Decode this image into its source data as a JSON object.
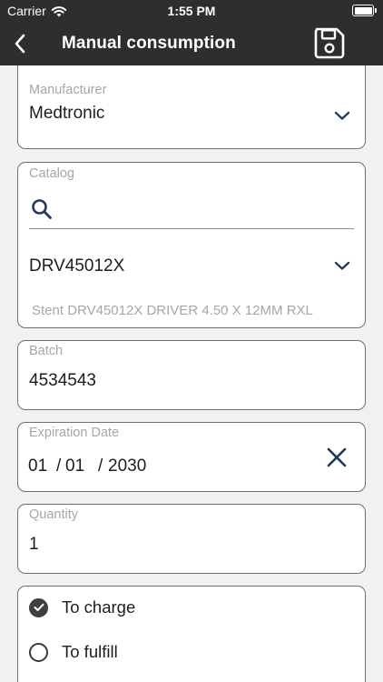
{
  "status_bar": {
    "carrier": "Carrier",
    "time": "1:55 PM",
    "icons": [
      "wifi-icon",
      "battery-icon"
    ]
  },
  "nav": {
    "title": "Manual consumption",
    "back_icon": "chevron-left-icon",
    "save_icon": "floppy-disk-icon"
  },
  "form": {
    "manufacturer": {
      "label": "Manufacturer",
      "value": "Medtronic"
    },
    "catalog": {
      "label": "Catalog",
      "search_value": "",
      "selected": "DRV45012X",
      "description": "Stent DRV45012X DRIVER 4.50 X 12MM RXL"
    },
    "batch": {
      "label": "Batch",
      "value": "4534543"
    },
    "expiration_date": {
      "label": "Expiration Date",
      "month": "01",
      "separator1": "/",
      "day": "01",
      "separator2": "/",
      "year": "2030"
    },
    "quantity": {
      "label": "Quantity",
      "value": "1"
    },
    "charge_options": [
      {
        "label": "To charge",
        "checked": true
      },
      {
        "label": "To fulfill",
        "checked": false
      }
    ]
  },
  "colors": {
    "header_bg": "#2e2e2e",
    "page_bg": "#f1f1f3",
    "accent_icon": "#1f3a5f",
    "label_gray": "#a6a6ab"
  }
}
